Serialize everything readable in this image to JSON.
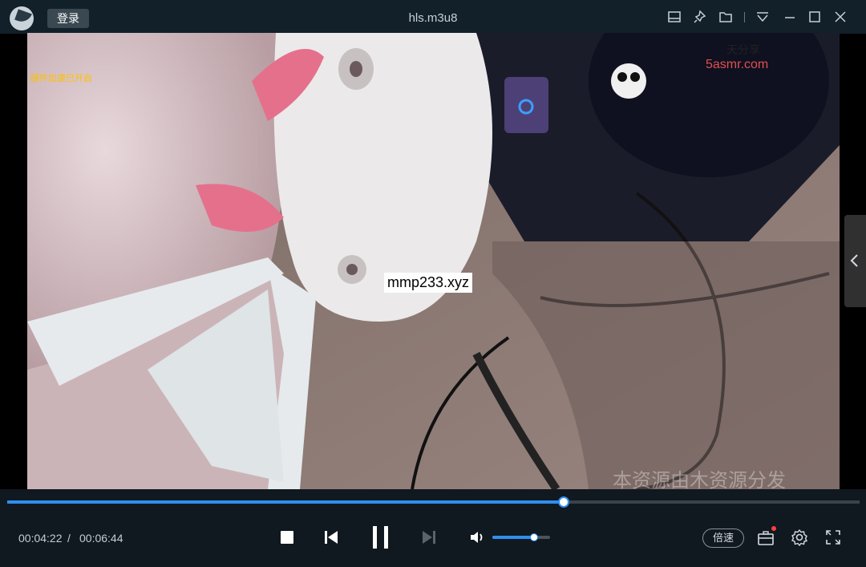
{
  "titlebar": {
    "login_label": "登录",
    "title": "hls.m3u8",
    "icons": [
      "screenshot-icon",
      "pin-icon",
      "folder-icon",
      "menu-icon",
      "minimize-icon",
      "maximize-icon",
      "close-icon"
    ]
  },
  "video": {
    "hw_accel_label": "硬件加速已开启",
    "overlay_watermark": "mmp233.xyz",
    "site_watermark": "5asmr.com",
    "corner_text_top": "天分享",
    "bottom_watermark": "本资源由木资源分发"
  },
  "progress": {
    "fraction": 0.6531
  },
  "controls": {
    "current_time": "00:04:22",
    "separator": "/",
    "total_time": "00:06:44",
    "volume_fraction": 0.72,
    "speed_label": "倍速"
  },
  "colors": {
    "accent": "#2f8ff0",
    "titlebar_bg": "#12202a",
    "control_bg": "#101820",
    "hw_label": "#ffc000",
    "badge": "#ff4040"
  }
}
